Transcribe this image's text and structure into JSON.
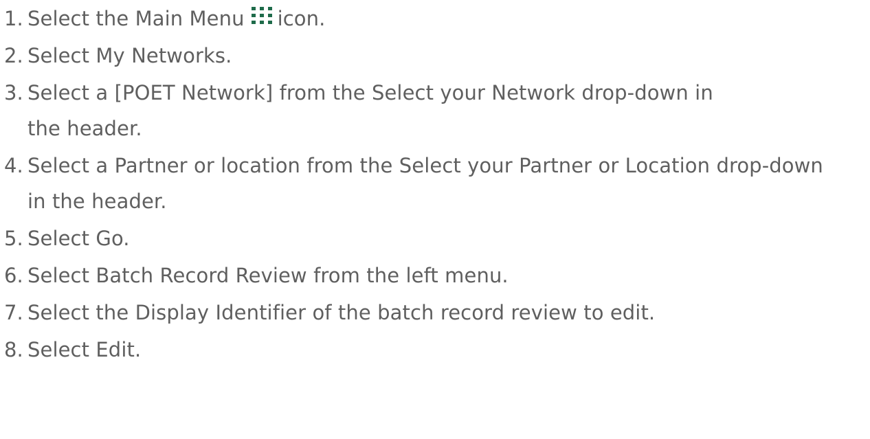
{
  "steps": [
    {
      "num": "1.",
      "before": "Select the Main Menu",
      "icon": "grid-dots-icon",
      "after": "icon."
    },
    {
      "num": "2.",
      "text": "Select My Networks."
    },
    {
      "num": "3.",
      "text": "Select a [POET Network] from the Select your Network drop-down in the header."
    },
    {
      "num": "4.",
      "text": "Select a Partner or location from the Select your Partner or Location drop-down in the header."
    },
    {
      "num": "5.",
      "text": "Select Go."
    },
    {
      "num": "6.",
      "text": "Select Batch Record Review from the left menu."
    },
    {
      "num": "7.",
      "text": "Select the Display Identifier of the batch record review to edit."
    },
    {
      "num": "8.",
      "text": "Select Edit."
    }
  ],
  "colors": {
    "text": "#5f5f5f",
    "icon": "#1e6b4a"
  }
}
